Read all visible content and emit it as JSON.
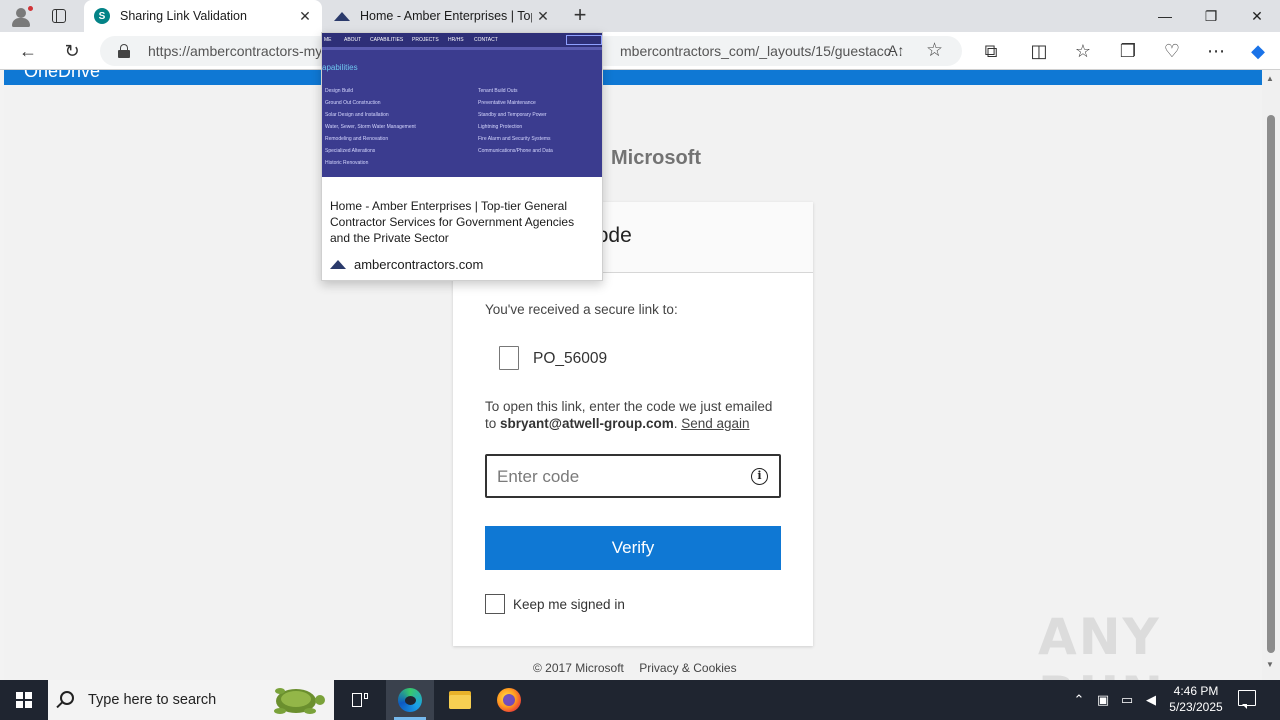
{
  "browser": {
    "tabs": [
      {
        "title": "Sharing Link Validation",
        "favicon": "sharepoint-icon",
        "active": true
      },
      {
        "title": "Home - Amber Enterprises | Top-tier General Contractor Services for Government Agencies and the Private Sector",
        "favicon": "amber-logo-icon",
        "active": false
      }
    ],
    "address_left": "https://ambercontractors-my",
    "address_right": "mbercontractors_com/_layouts/15/guestacc...",
    "read_aloud_label": "A↑",
    "window_controls": {
      "minimize": "—",
      "restore": "❐",
      "close": "✕"
    }
  },
  "tab_preview": {
    "title": "Home - Amber Enterprises | Top-tier General Contractor Services for Government Agencies and the Private Sector",
    "domain": "ambercontractors.com",
    "thumb_heading": "apabilities"
  },
  "page": {
    "header_text": "OneDrive",
    "brand": "Microsoft",
    "brand_colors": [
      "#f25022",
      "#7fba00",
      "#00a4ef",
      "#ffb900"
    ],
    "card_title": "Verification Code",
    "received_text": "You've received a secure link to:",
    "document_name": "PO_56009",
    "instruction_prefix": "To open this link, enter the code we just emailed to ",
    "email": "sbryant@atwell-group.com",
    "instruction_suffix": ". ",
    "send_again": "Send again",
    "code_placeholder": "Enter code",
    "info_icon_glyph": "i",
    "verify_label": "Verify",
    "keep_signed_in": "Keep me signed in",
    "footer_copyright": "© 2017 Microsoft",
    "footer_privacy": "Privacy & Cookies",
    "accent_color": "#0f78d4"
  },
  "watermark": "ANY RUN",
  "taskbar": {
    "search_placeholder": "Type here to search",
    "time": "4:46 PM",
    "date": "5/23/2025"
  }
}
